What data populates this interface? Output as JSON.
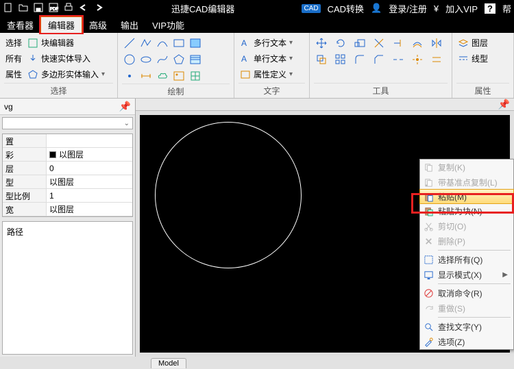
{
  "app": {
    "title": "迅捷CAD编辑器"
  },
  "titlebar_right": {
    "cad_badge": "CAD",
    "convert": "CAD转换",
    "login": "登录/注册",
    "yen": "¥",
    "vip": "加入VIP",
    "help": "?",
    "help_label": "帮"
  },
  "menubar": [
    "查看器",
    "编辑器",
    "高级",
    "输出",
    "VIP功能"
  ],
  "ribbon": {
    "group1": {
      "label": "选择",
      "items": [
        "选择",
        "所有",
        "属性"
      ],
      "right": [
        "块编辑器",
        "快速实体导入",
        "多边形实体输入"
      ]
    },
    "group_draw": {
      "label": "绘制"
    },
    "group_text": {
      "label": "文字",
      "items": [
        "多行文本",
        "单行文本",
        "属性定义"
      ]
    },
    "group_tools": {
      "label": "工具"
    },
    "group_props": {
      "label": "属性",
      "items": [
        "图层",
        "线型"
      ]
    }
  },
  "sidebar": {
    "file_suffix": "vg",
    "props": [
      {
        "k": "置",
        "v": ""
      },
      {
        "k": "彩",
        "v": "以图层",
        "swatch": true
      },
      {
        "k": "层",
        "v": "0"
      },
      {
        "k": "型",
        "v": "以图层"
      },
      {
        "k": "型比例",
        "v": "1"
      },
      {
        "k": "宽",
        "v": "以图层"
      }
    ],
    "path_label": "路径"
  },
  "tabstrip": {
    "model": "Model"
  },
  "context_menu": [
    {
      "label": "复制(K)",
      "icon": "copy",
      "disabled": true
    },
    {
      "label": "带基准点复制(L)",
      "icon": "copy-base",
      "disabled": true
    },
    {
      "label": "粘贴(M)",
      "icon": "paste",
      "highlight": true
    },
    {
      "label": "粘贴为块(N)",
      "icon": "paste-block"
    },
    {
      "label": "剪切(O)",
      "icon": "cut",
      "disabled": true
    },
    {
      "label": "删除(P)",
      "icon": "delete",
      "disabled": true
    },
    {
      "sep": true
    },
    {
      "label": "选择所有(Q)",
      "icon": "select-all"
    },
    {
      "label": "显示模式(X)",
      "icon": "display",
      "submenu": true
    },
    {
      "sep": true
    },
    {
      "label": "取消命令(R)",
      "icon": "cancel"
    },
    {
      "label": "重做(S)",
      "icon": "redo",
      "disabled": true
    },
    {
      "sep": true
    },
    {
      "label": "查找文字(Y)",
      "icon": "find"
    },
    {
      "label": "选项(Z)",
      "icon": "options"
    }
  ]
}
